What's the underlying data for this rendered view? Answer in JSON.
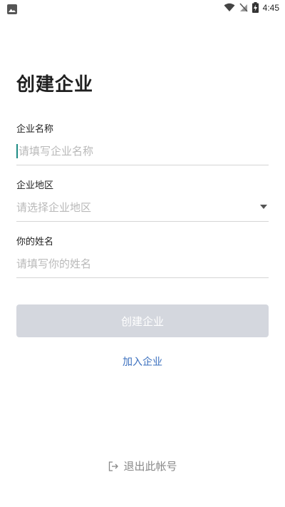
{
  "status_bar": {
    "time": "4:45",
    "icons": [
      "image-icon",
      "wifi-icon",
      "signal-off-icon",
      "battery-charging-icon"
    ]
  },
  "page": {
    "title": "创建企业"
  },
  "form": {
    "company_name": {
      "label": "企业名称",
      "placeholder": "请填写企业名称",
      "value": ""
    },
    "company_region": {
      "label": "企业地区",
      "placeholder": "请选择企业地区",
      "value": ""
    },
    "your_name": {
      "label": "你的姓名",
      "placeholder": "请填写你的姓名",
      "value": ""
    }
  },
  "actions": {
    "create_label": "创建企业",
    "join_label": "加入企业",
    "logout_label": "退出此帐号"
  },
  "colors": {
    "cursor": "#1d8b84",
    "button_disabled": "#d4d7de",
    "link": "#3a6fbe",
    "muted": "#888888"
  }
}
